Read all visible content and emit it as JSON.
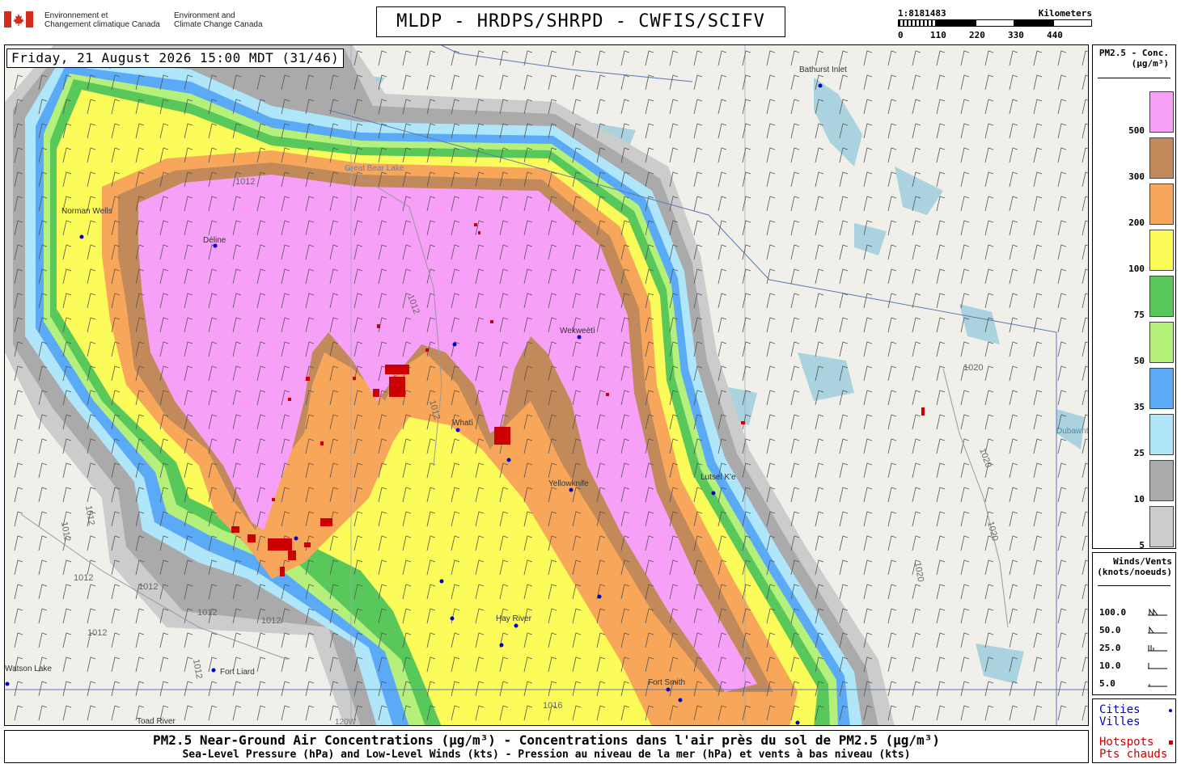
{
  "header": {
    "gov_fr_line1": "Environnement et",
    "gov_fr_line2": "Changement climatique Canada",
    "gov_en_line1": "Environment and",
    "gov_en_line2": "Climate Change Canada",
    "title": "MLDP - HRDPS/SHRPD - CWFIS/SCIFV"
  },
  "scale": {
    "ratio": "1:8181483",
    "unit": "Kilometers",
    "ticks": [
      "0",
      "110",
      "220",
      "330",
      "440"
    ]
  },
  "map": {
    "timestamp": "Friday, 21 August 2026 15:00 MDT (31/46)",
    "cities": [
      "Déline",
      "Wekweètì",
      "Whatì",
      "Yellowknife",
      "Hay River",
      "Fort Smith",
      "Fort Liard",
      "Bathurst Inlet",
      "Lutsel K'e",
      "Norman Wells",
      "Toad River",
      "Watson Lake"
    ],
    "isobars": [
      "1012",
      "1012",
      "1012",
      "1012",
      "1012",
      "1012",
      "1012",
      "1012",
      "1012",
      "1012",
      "1012",
      "1012",
      "1016",
      "1020",
      "1020",
      "1020",
      "1020"
    ],
    "lakes": [
      "Great Bear Lake",
      "Dubawnt Lake"
    ],
    "meridian": "120W"
  },
  "legend_pm25": {
    "title_line1": "PM2.5 - Conc.",
    "title_line2": "(µg/m³)",
    "classes": [
      {
        "label": "500",
        "color": "#f7a0f7"
      },
      {
        "label": "300",
        "color": "#c28a5a"
      },
      {
        "label": "200",
        "color": "#f8a65a"
      },
      {
        "label": "100",
        "color": "#fbfb59"
      },
      {
        "label": "75",
        "color": "#58c85a"
      },
      {
        "label": "50",
        "color": "#b4f07a"
      },
      {
        "label": "35",
        "color": "#5aaaf8"
      },
      {
        "label": "25",
        "color": "#b0e6fa"
      },
      {
        "label": "10",
        "color": "#aaaaaa"
      },
      {
        "label": "5",
        "color": "#cccccc"
      }
    ]
  },
  "legend_winds": {
    "title_line1": "Winds/Vents",
    "title_line2": "(knots/noeuds)",
    "rows": [
      "100.0",
      "50.0",
      "25.0",
      "10.0",
      "5.0"
    ]
  },
  "legend_points": {
    "cities": "Cities",
    "villes": "Villes",
    "hotspots": "Hotspots",
    "pts_chauds": "Pts chauds",
    "city_color": "#0000cc",
    "hotspot_color": "#cc0000"
  },
  "footer": {
    "line1": "PM2.5 Near-Ground Air Concentrations (µg/m³) - Concentrations dans l'air près du sol de PM2.5 (µg/m³)",
    "line2": "Sea-Level Pressure (hPa) and Low-Level Winds (kts) - Pression au niveau de la mer (hPa) et vents à bas niveau (kts)"
  }
}
